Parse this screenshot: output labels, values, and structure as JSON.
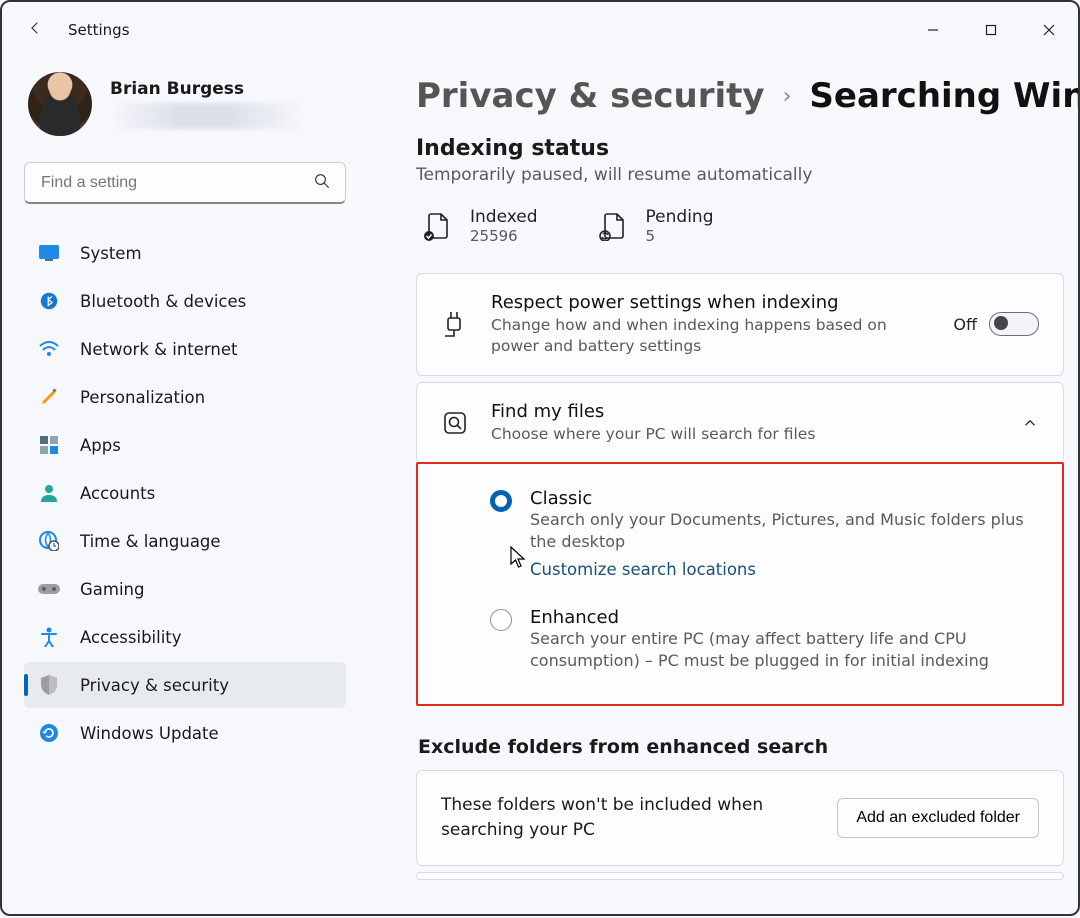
{
  "app": {
    "title": "Settings"
  },
  "user": {
    "name": "Brian Burgess"
  },
  "search": {
    "placeholder": "Find a setting"
  },
  "sidebar": {
    "items": [
      {
        "label": "System"
      },
      {
        "label": "Bluetooth & devices"
      },
      {
        "label": "Network & internet"
      },
      {
        "label": "Personalization"
      },
      {
        "label": "Apps"
      },
      {
        "label": "Accounts"
      },
      {
        "label": "Time & language"
      },
      {
        "label": "Gaming"
      },
      {
        "label": "Accessibility"
      },
      {
        "label": "Privacy & security"
      },
      {
        "label": "Windows Update"
      }
    ]
  },
  "breadcrumb": {
    "parent": "Privacy & security",
    "current": "Searching Windows"
  },
  "indexing": {
    "heading": "Indexing status",
    "sub": "Temporarily paused, will resume automatically",
    "indexed_label": "Indexed",
    "indexed_value": "25596",
    "pending_label": "Pending",
    "pending_value": "5"
  },
  "power": {
    "title": "Respect power settings when indexing",
    "sub": "Change how and when indexing happens based on power and battery settings",
    "state": "Off"
  },
  "find": {
    "title": "Find my files",
    "sub": "Choose where your PC will search for files",
    "classic": {
      "title": "Classic",
      "sub": "Search only your Documents, Pictures, and Music folders plus the desktop",
      "link": "Customize search locations"
    },
    "enhanced": {
      "title": "Enhanced",
      "sub": "Search your entire PC (may affect battery life and CPU consumption) – PC must be plugged in for initial indexing"
    }
  },
  "exclude": {
    "heading": "Exclude folders from enhanced search",
    "msg": "These folders won't be included when searching your PC",
    "button": "Add an excluded folder"
  }
}
